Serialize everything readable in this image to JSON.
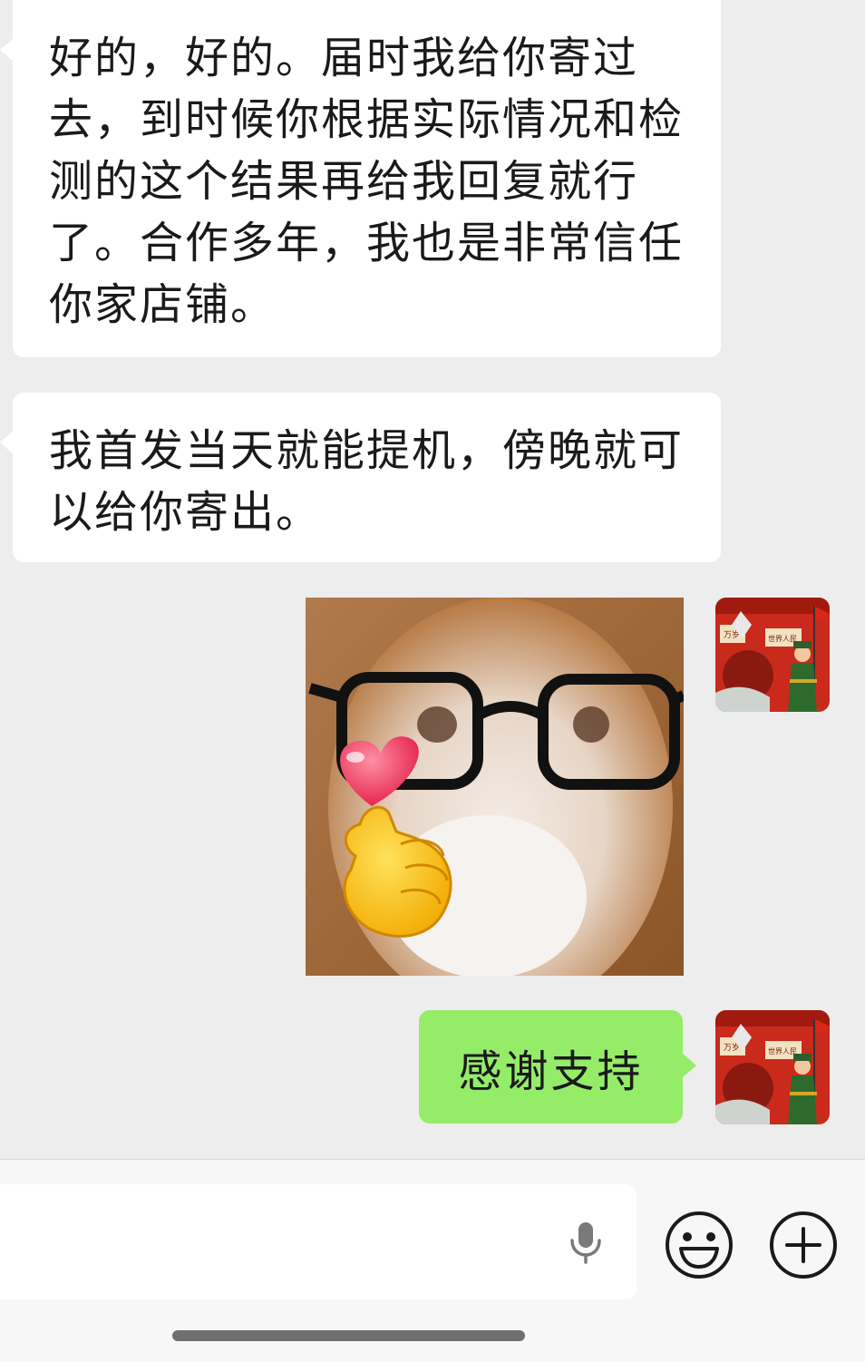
{
  "messages": {
    "incoming_1": "好的，好的。届时我给你寄过去，到时候你根据实际情况和检测的这个结果再给我回复就行了。合作多年，我也是非常信任你家店铺。",
    "incoming_2": "我首发当天就能提机，傍晚就可以给你寄出。",
    "outgoing_1": "感谢支持"
  },
  "avatar": {
    "sign_text": "世界人民",
    "sign_text2": "万岁"
  },
  "input_bar": {
    "text_value": ""
  },
  "icons": {
    "voice": "microphone-icon",
    "emoji": "smiley-icon",
    "more": "plus-icon"
  },
  "colors": {
    "chat_background": "#ededed",
    "incoming_bubble": "#ffffff",
    "outgoing_bubble": "#95ec69"
  }
}
